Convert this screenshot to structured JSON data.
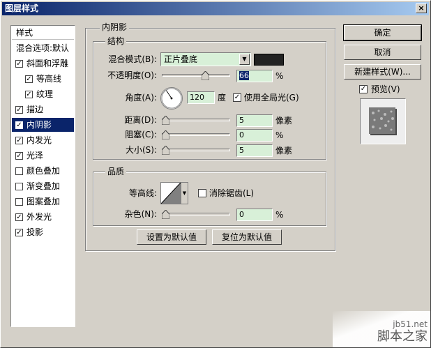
{
  "window": {
    "title": "图层样式",
    "close": "×"
  },
  "style_list": {
    "header": "样式",
    "items": [
      {
        "label": "混合选项:默认",
        "checkbox": false,
        "checked": false,
        "indent": 0,
        "selected": false
      },
      {
        "label": "斜面和浮雕",
        "checkbox": true,
        "checked": true,
        "indent": 0,
        "selected": false
      },
      {
        "label": "等高线",
        "checkbox": true,
        "checked": true,
        "indent": 1,
        "selected": false
      },
      {
        "label": "纹理",
        "checkbox": true,
        "checked": true,
        "indent": 1,
        "selected": false
      },
      {
        "label": "描边",
        "checkbox": true,
        "checked": true,
        "indent": 0,
        "selected": false
      },
      {
        "label": "内阴影",
        "checkbox": true,
        "checked": true,
        "indent": 0,
        "selected": true
      },
      {
        "label": "内发光",
        "checkbox": true,
        "checked": true,
        "indent": 0,
        "selected": false
      },
      {
        "label": "光泽",
        "checkbox": true,
        "checked": true,
        "indent": 0,
        "selected": false
      },
      {
        "label": "颜色叠加",
        "checkbox": true,
        "checked": false,
        "indent": 0,
        "selected": false
      },
      {
        "label": "渐变叠加",
        "checkbox": true,
        "checked": false,
        "indent": 0,
        "selected": false
      },
      {
        "label": "图案叠加",
        "checkbox": true,
        "checked": false,
        "indent": 0,
        "selected": false
      },
      {
        "label": "外发光",
        "checkbox": true,
        "checked": true,
        "indent": 0,
        "selected": false
      },
      {
        "label": "投影",
        "checkbox": true,
        "checked": true,
        "indent": 0,
        "selected": false
      }
    ]
  },
  "inner_shadow": {
    "title": "内阴影",
    "structure": {
      "title": "结构",
      "blend_mode_label": "混合模式(B):",
      "blend_mode_value": "正片叠底",
      "color": "#222222",
      "opacity_label": "不透明度(O):",
      "opacity_value": "66",
      "opacity_unit": "%",
      "opacity_level": 0.66,
      "angle_label": "角度(A):",
      "angle_value": "120",
      "angle_unit": "度",
      "global_light_label": "使用全局光(G)",
      "global_light_checked": true,
      "distance_label": "距离(D):",
      "distance_value": "5",
      "distance_unit": "像素",
      "choke_label": "阻塞(C):",
      "choke_value": "0",
      "choke_unit": "%",
      "size_label": "大小(S):",
      "size_value": "5",
      "size_unit": "像素"
    },
    "quality": {
      "title": "品质",
      "contour_label": "等高线:",
      "antialias_label": "消除锯齿(L)",
      "antialias_checked": false,
      "noise_label": "杂色(N):",
      "noise_value": "0",
      "noise_unit": "%"
    },
    "make_default": "设置为默认值",
    "reset_default": "复位为默认值"
  },
  "buttons": {
    "ok": "确定",
    "cancel": "取消",
    "new_style": "新建样式(W)...",
    "preview_label": "预览(V)",
    "preview_checked": true
  },
  "watermark": {
    "line1": "jb51.net",
    "line2": "脚本之家"
  }
}
